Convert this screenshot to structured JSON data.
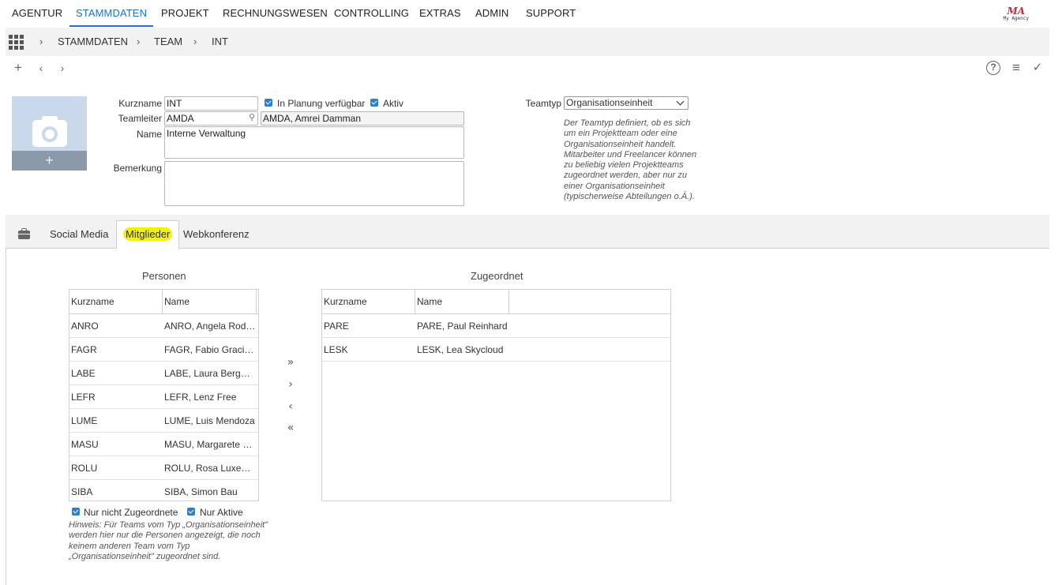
{
  "nav": {
    "items": [
      "AGENTUR",
      "STAMMDATEN",
      "PROJEKT",
      "RECHNUNGSWESEN",
      "CONTROLLING",
      "EXTRAS",
      "ADMIN",
      "SUPPORT"
    ],
    "active": "STAMMDATEN",
    "logo_text": "My Agency",
    "logo_mark": "MA"
  },
  "breadcrumb": [
    "STAMMDATEN",
    "TEAM",
    "INT"
  ],
  "form": {
    "kurzname_label": "Kurzname",
    "kurzname_value": "INT",
    "in_planung_label": "In Planung verfügbar",
    "aktiv_label": "Aktiv",
    "teamleiter_label": "Teamleiter",
    "teamleiter_value": "AMDA",
    "teamleiter_name": "AMDA, Amrei Damman",
    "name_label": "Name",
    "name_value": "Interne Verwaltung",
    "bemerkung_label": "Bemerkung",
    "bemerkung_value": "",
    "teamtyp_label": "Teamtyp",
    "teamtyp_value": "Organisationseinheit",
    "teamtyp_hint": [
      "Der Teamtyp definiert, ob es sich",
      "um ein Projektteam oder eine",
      "Organisationseinheit handelt.",
      "Mitarbeiter und Freelancer können",
      "zu beliebig vielen Projektteams",
      "zugeordnet werden, aber nur zu",
      "einer Organisationseinheit",
      "(typischerweise Abteilungen o.Ä.)."
    ]
  },
  "tabs": [
    "Social Media",
    "Mitglieder",
    "Webkonferenz"
  ],
  "active_tab": "Mitglieder",
  "personen": {
    "title": "Personen",
    "columns": [
      "Kurzname",
      "Name"
    ],
    "rows": [
      [
        "ANRO",
        "ANRO, Angela Rodrig..."
      ],
      [
        "FAGR",
        "FAGR, Fabio Graciano"
      ],
      [
        "LABE",
        "LABE, Laura Bergmann"
      ],
      [
        "LEFR",
        "LEFR, Lenz Free"
      ],
      [
        "LUME",
        "LUME, Luis Mendoza"
      ],
      [
        "MASU",
        "MASU, Margarete Sull..."
      ],
      [
        "ROLU",
        "ROLU, Rosa Luxemburg"
      ],
      [
        "SIBA",
        "SIBA, Simon Bau"
      ]
    ]
  },
  "zugeordnet": {
    "title": "Zugeordnet",
    "columns": [
      "Kurzname",
      "Name"
    ],
    "rows": [
      [
        "PARE",
        "PARE, Paul Reinhard"
      ],
      [
        "LESK",
        "LESK, Lea Skycloud"
      ]
    ]
  },
  "filters": {
    "nur_nicht_zugeordnete": "Nur nicht Zugeordnete",
    "nur_aktive": "Nur Aktive",
    "hint": [
      "Hinweis: Für Teams vom Typ „Organisationseinheit\"",
      "werden hier nur die Personen angezeigt, die noch",
      "keinem anderen Team vom Typ",
      "„Organisationseinheit\" zugeordnet sind."
    ]
  },
  "move_buttons": [
    "»",
    "›",
    "‹",
    "«"
  ],
  "colors": {
    "accent": "#1a73c7",
    "checkbox": "#2f7fd1",
    "highlight": "#f2f20a"
  }
}
